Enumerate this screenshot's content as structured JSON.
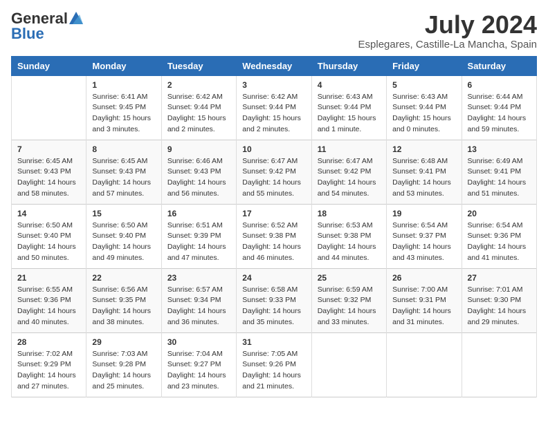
{
  "logo": {
    "general": "General",
    "blue": "Blue"
  },
  "title": {
    "month_year": "July 2024",
    "location": "Esplegares, Castille-La Mancha, Spain"
  },
  "weekdays": [
    "Sunday",
    "Monday",
    "Tuesday",
    "Wednesday",
    "Thursday",
    "Friday",
    "Saturday"
  ],
  "weeks": [
    [
      {
        "day": "",
        "sunrise": "",
        "sunset": "",
        "daylight": ""
      },
      {
        "day": "1",
        "sunrise": "Sunrise: 6:41 AM",
        "sunset": "Sunset: 9:45 PM",
        "daylight": "Daylight: 15 hours and 3 minutes."
      },
      {
        "day": "2",
        "sunrise": "Sunrise: 6:42 AM",
        "sunset": "Sunset: 9:44 PM",
        "daylight": "Daylight: 15 hours and 2 minutes."
      },
      {
        "day": "3",
        "sunrise": "Sunrise: 6:42 AM",
        "sunset": "Sunset: 9:44 PM",
        "daylight": "Daylight: 15 hours and 2 minutes."
      },
      {
        "day": "4",
        "sunrise": "Sunrise: 6:43 AM",
        "sunset": "Sunset: 9:44 PM",
        "daylight": "Daylight: 15 hours and 1 minute."
      },
      {
        "day": "5",
        "sunrise": "Sunrise: 6:43 AM",
        "sunset": "Sunset: 9:44 PM",
        "daylight": "Daylight: 15 hours and 0 minutes."
      },
      {
        "day": "6",
        "sunrise": "Sunrise: 6:44 AM",
        "sunset": "Sunset: 9:44 PM",
        "daylight": "Daylight: 14 hours and 59 minutes."
      }
    ],
    [
      {
        "day": "7",
        "sunrise": "Sunrise: 6:45 AM",
        "sunset": "Sunset: 9:43 PM",
        "daylight": "Daylight: 14 hours and 58 minutes."
      },
      {
        "day": "8",
        "sunrise": "Sunrise: 6:45 AM",
        "sunset": "Sunset: 9:43 PM",
        "daylight": "Daylight: 14 hours and 57 minutes."
      },
      {
        "day": "9",
        "sunrise": "Sunrise: 6:46 AM",
        "sunset": "Sunset: 9:43 PM",
        "daylight": "Daylight: 14 hours and 56 minutes."
      },
      {
        "day": "10",
        "sunrise": "Sunrise: 6:47 AM",
        "sunset": "Sunset: 9:42 PM",
        "daylight": "Daylight: 14 hours and 55 minutes."
      },
      {
        "day": "11",
        "sunrise": "Sunrise: 6:47 AM",
        "sunset": "Sunset: 9:42 PM",
        "daylight": "Daylight: 14 hours and 54 minutes."
      },
      {
        "day": "12",
        "sunrise": "Sunrise: 6:48 AM",
        "sunset": "Sunset: 9:41 PM",
        "daylight": "Daylight: 14 hours and 53 minutes."
      },
      {
        "day": "13",
        "sunrise": "Sunrise: 6:49 AM",
        "sunset": "Sunset: 9:41 PM",
        "daylight": "Daylight: 14 hours and 51 minutes."
      }
    ],
    [
      {
        "day": "14",
        "sunrise": "Sunrise: 6:50 AM",
        "sunset": "Sunset: 9:40 PM",
        "daylight": "Daylight: 14 hours and 50 minutes."
      },
      {
        "day": "15",
        "sunrise": "Sunrise: 6:50 AM",
        "sunset": "Sunset: 9:40 PM",
        "daylight": "Daylight: 14 hours and 49 minutes."
      },
      {
        "day": "16",
        "sunrise": "Sunrise: 6:51 AM",
        "sunset": "Sunset: 9:39 PM",
        "daylight": "Daylight: 14 hours and 47 minutes."
      },
      {
        "day": "17",
        "sunrise": "Sunrise: 6:52 AM",
        "sunset": "Sunset: 9:38 PM",
        "daylight": "Daylight: 14 hours and 46 minutes."
      },
      {
        "day": "18",
        "sunrise": "Sunrise: 6:53 AM",
        "sunset": "Sunset: 9:38 PM",
        "daylight": "Daylight: 14 hours and 44 minutes."
      },
      {
        "day": "19",
        "sunrise": "Sunrise: 6:54 AM",
        "sunset": "Sunset: 9:37 PM",
        "daylight": "Daylight: 14 hours and 43 minutes."
      },
      {
        "day": "20",
        "sunrise": "Sunrise: 6:54 AM",
        "sunset": "Sunset: 9:36 PM",
        "daylight": "Daylight: 14 hours and 41 minutes."
      }
    ],
    [
      {
        "day": "21",
        "sunrise": "Sunrise: 6:55 AM",
        "sunset": "Sunset: 9:36 PM",
        "daylight": "Daylight: 14 hours and 40 minutes."
      },
      {
        "day": "22",
        "sunrise": "Sunrise: 6:56 AM",
        "sunset": "Sunset: 9:35 PM",
        "daylight": "Daylight: 14 hours and 38 minutes."
      },
      {
        "day": "23",
        "sunrise": "Sunrise: 6:57 AM",
        "sunset": "Sunset: 9:34 PM",
        "daylight": "Daylight: 14 hours and 36 minutes."
      },
      {
        "day": "24",
        "sunrise": "Sunrise: 6:58 AM",
        "sunset": "Sunset: 9:33 PM",
        "daylight": "Daylight: 14 hours and 35 minutes."
      },
      {
        "day": "25",
        "sunrise": "Sunrise: 6:59 AM",
        "sunset": "Sunset: 9:32 PM",
        "daylight": "Daylight: 14 hours and 33 minutes."
      },
      {
        "day": "26",
        "sunrise": "Sunrise: 7:00 AM",
        "sunset": "Sunset: 9:31 PM",
        "daylight": "Daylight: 14 hours and 31 minutes."
      },
      {
        "day": "27",
        "sunrise": "Sunrise: 7:01 AM",
        "sunset": "Sunset: 9:30 PM",
        "daylight": "Daylight: 14 hours and 29 minutes."
      }
    ],
    [
      {
        "day": "28",
        "sunrise": "Sunrise: 7:02 AM",
        "sunset": "Sunset: 9:29 PM",
        "daylight": "Daylight: 14 hours and 27 minutes."
      },
      {
        "day": "29",
        "sunrise": "Sunrise: 7:03 AM",
        "sunset": "Sunset: 9:28 PM",
        "daylight": "Daylight: 14 hours and 25 minutes."
      },
      {
        "day": "30",
        "sunrise": "Sunrise: 7:04 AM",
        "sunset": "Sunset: 9:27 PM",
        "daylight": "Daylight: 14 hours and 23 minutes."
      },
      {
        "day": "31",
        "sunrise": "Sunrise: 7:05 AM",
        "sunset": "Sunset: 9:26 PM",
        "daylight": "Daylight: 14 hours and 21 minutes."
      },
      {
        "day": "",
        "sunrise": "",
        "sunset": "",
        "daylight": ""
      },
      {
        "day": "",
        "sunrise": "",
        "sunset": "",
        "daylight": ""
      },
      {
        "day": "",
        "sunrise": "",
        "sunset": "",
        "daylight": ""
      }
    ]
  ]
}
